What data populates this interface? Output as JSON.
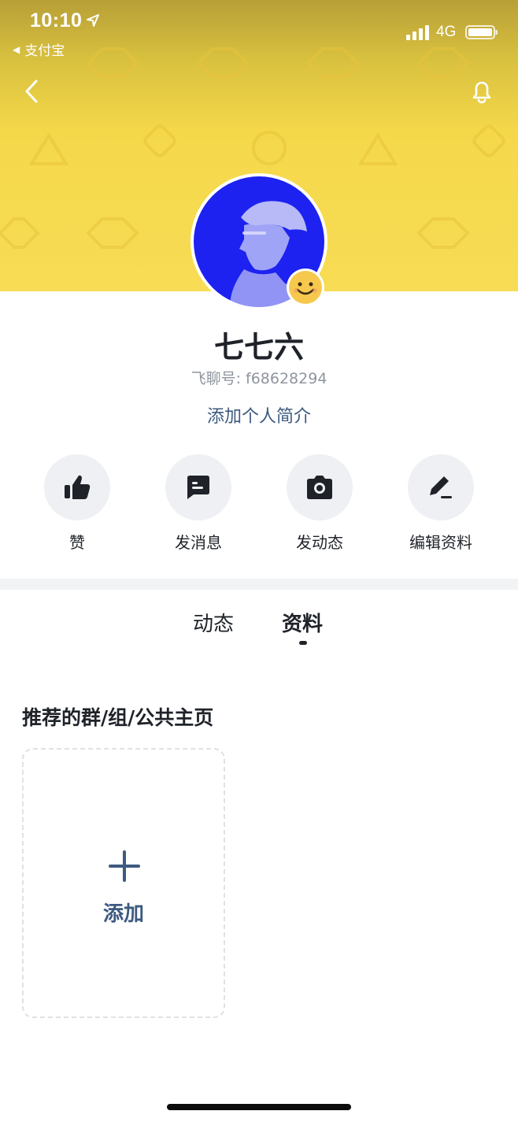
{
  "status_bar": {
    "time": "10:10",
    "back_app": "支付宝",
    "network": "4G"
  },
  "profile": {
    "name": "七七六",
    "id_text": "飞聊号: f68628294",
    "add_bio": "添加个人简介"
  },
  "actions": [
    {
      "label": "赞",
      "icon": "thumbs-up-icon"
    },
    {
      "label": "发消息",
      "icon": "message-icon"
    },
    {
      "label": "发动态",
      "icon": "camera-icon"
    },
    {
      "label": "编辑资料",
      "icon": "edit-icon"
    }
  ],
  "tabs": [
    {
      "label": "动态",
      "active": false
    },
    {
      "label": "资料",
      "active": true
    }
  ],
  "section": {
    "title": "推荐的群/组/公共主页",
    "add_label": "添加"
  },
  "colors": {
    "header_yellow": "#f5d84a",
    "accent_blue": "#3d5a80",
    "avatar_blue": "#1d22f0"
  }
}
